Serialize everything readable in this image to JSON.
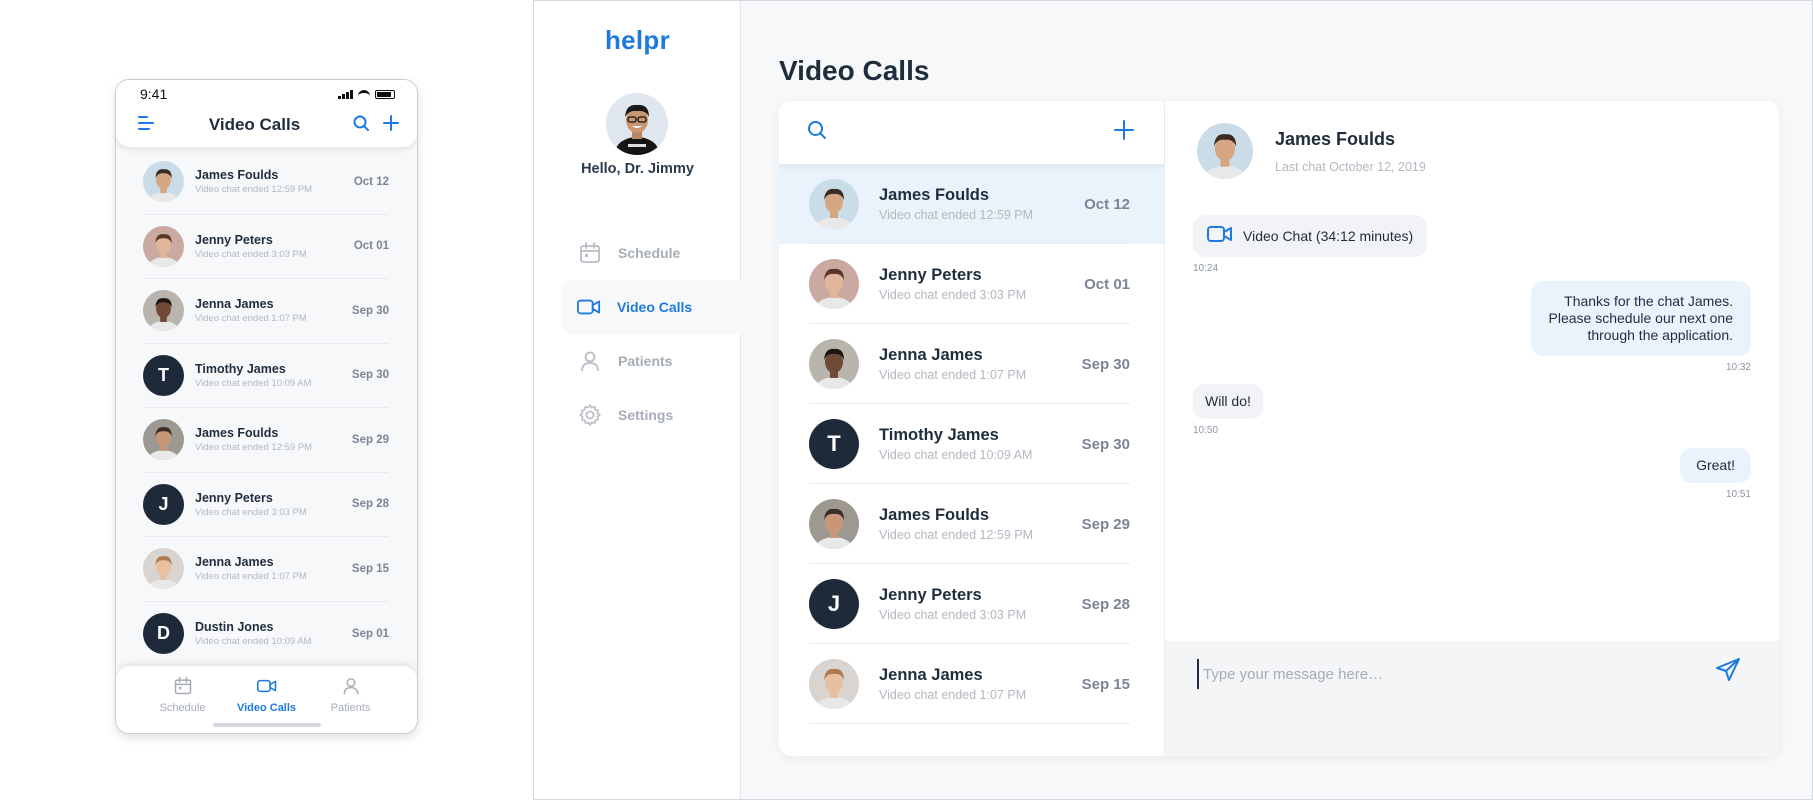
{
  "colors": {
    "accent": "#1f7ae0",
    "dark_avatar": "#1e2a3a",
    "selected_row": "#eaf3fc"
  },
  "mobile": {
    "status_time": "9:41",
    "title": "Video Calls",
    "icons": [
      "menu-icon",
      "search-icon",
      "plus-icon"
    ],
    "items": [
      {
        "name": "James Foulds",
        "sub": "Video chat ended 12:59 PM",
        "date": "Oct 12",
        "avatar": "photo",
        "initial": ""
      },
      {
        "name": "Jenny Peters",
        "sub": "Video chat ended 3:03 PM",
        "date": "Oct 01",
        "avatar": "photo",
        "initial": ""
      },
      {
        "name": "Jenna James",
        "sub": "Video chat ended 1:07 PM",
        "date": "Sep 30",
        "avatar": "photo",
        "initial": ""
      },
      {
        "name": "Timothy James",
        "sub": "Video chat ended 10:09 AM",
        "date": "Sep 30",
        "avatar": "initial",
        "initial": "T"
      },
      {
        "name": "James Foulds",
        "sub": "Video chat ended 12:59 PM",
        "date": "Sep 29",
        "avatar": "photo",
        "initial": ""
      },
      {
        "name": "Jenny Peters",
        "sub": "Video chat ended 3:03 PM",
        "date": "Sep 28",
        "avatar": "initial",
        "initial": "J"
      },
      {
        "name": "Jenna James",
        "sub": "Video chat ended 1:07 PM",
        "date": "Sep 15",
        "avatar": "photo",
        "initial": ""
      },
      {
        "name": "Dustin Jones",
        "sub": "Video chat ended 10:09 AM",
        "date": "Sep 01",
        "avatar": "initial",
        "initial": "D"
      }
    ],
    "tabs": [
      {
        "label": "Schedule",
        "icon": "calendar-icon",
        "active": false
      },
      {
        "label": "Video Calls",
        "icon": "video-camera-icon",
        "active": true
      },
      {
        "label": "Patients",
        "icon": "person-icon",
        "active": false
      }
    ]
  },
  "desktop": {
    "brand": "helpr",
    "greeting": "Hello, Dr. Jimmy",
    "nav": [
      {
        "label": "Schedule",
        "icon": "calendar-icon",
        "active": false
      },
      {
        "label": "Video Calls",
        "icon": "video-camera-icon",
        "active": true
      },
      {
        "label": "Patients",
        "icon": "person-icon",
        "active": false
      },
      {
        "label": "Settings",
        "icon": "gear-icon",
        "active": false
      }
    ],
    "page_title": "Video Calls",
    "list": [
      {
        "name": "James Foulds",
        "sub": "Video chat ended 12:59 PM",
        "date": "Oct 12",
        "avatar": "photo",
        "initial": "",
        "selected": true
      },
      {
        "name": "Jenny Peters",
        "sub": "Video chat ended 3:03 PM",
        "date": "Oct 01",
        "avatar": "photo",
        "initial": "",
        "selected": false
      },
      {
        "name": "Jenna James",
        "sub": "Video chat ended 1:07 PM",
        "date": "Sep 30",
        "avatar": "photo",
        "initial": "",
        "selected": false
      },
      {
        "name": "Timothy James",
        "sub": "Video chat ended 10:09 AM",
        "date": "Sep 30",
        "avatar": "initial",
        "initial": "T",
        "selected": false
      },
      {
        "name": "James Foulds",
        "sub": "Video chat ended 12:59 PM",
        "date": "Sep 29",
        "avatar": "photo",
        "initial": "",
        "selected": false
      },
      {
        "name": "Jenny Peters",
        "sub": "Video chat ended 3:03 PM",
        "date": "Sep 28",
        "avatar": "initial",
        "initial": "J",
        "selected": false
      },
      {
        "name": "Jenna James",
        "sub": "Video chat ended 1:07 PM",
        "date": "Sep 15",
        "avatar": "photo",
        "initial": "",
        "selected": false
      }
    ],
    "chat": {
      "name": "James Foulds",
      "last_chat": "Last chat October 12, 2019",
      "messages": [
        {
          "type": "call",
          "text": "Video Chat (34:12 minutes)",
          "time": "10:24",
          "side": "in"
        },
        {
          "type": "text",
          "text": "Thanks for the chat James.\nPlease schedule our next one\nthrough the application.",
          "time": "10:32",
          "side": "out"
        },
        {
          "type": "text",
          "text": "Will do!",
          "time": "10:50",
          "side": "in"
        },
        {
          "type": "text",
          "text": "Great!",
          "time": "10:51",
          "side": "out"
        }
      ],
      "composer_placeholder": "Type your message here…"
    }
  }
}
